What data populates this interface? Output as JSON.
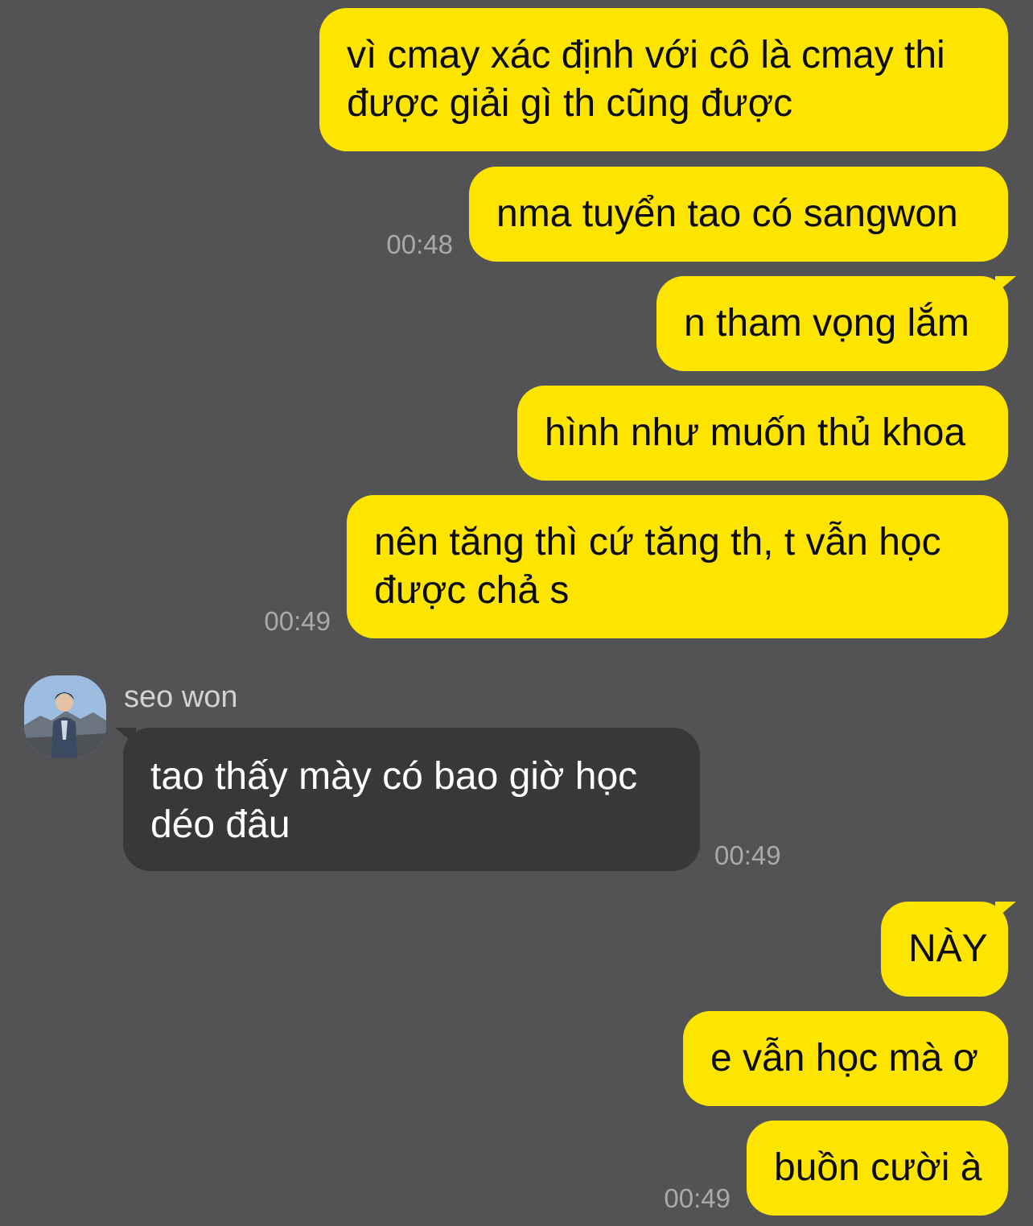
{
  "messages": [
    {
      "text": "vì cmay xác định với cô là cmay thi được giải gì th cũng được"
    },
    {
      "text": "nma tuyển tao có sangwon",
      "time": "00:48"
    },
    {
      "text": "n tham vọng lắm"
    },
    {
      "text": "hình như muốn thủ khoa"
    },
    {
      "text": "nên tăng thì cứ tăng th, t vẫn học được chả s",
      "time": "00:49"
    },
    {
      "sender": "seo won",
      "text": "tao thấy mày có bao giờ học déo đâu",
      "time": "00:49"
    },
    {
      "text": "NÀY"
    },
    {
      "text": "e vẫn học mà ơ"
    },
    {
      "text": "buồn cười à",
      "time": "00:49"
    }
  ],
  "colors": {
    "background": "#535254",
    "my_bubble": "#fee500",
    "their_bubble": "#383739",
    "timestamp": "#a9a8ab"
  },
  "icons": {
    "avatar": "profile-photo"
  }
}
